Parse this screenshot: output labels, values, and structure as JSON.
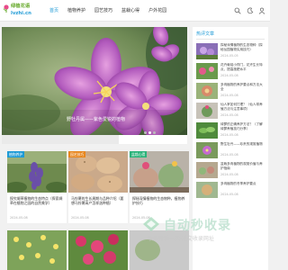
{
  "header": {
    "logo_text": "绿植花语",
    "logo_sub": "lvzhi.cn",
    "nav": [
      {
        "label": "首页"
      },
      {
        "label": "植物养护"
      },
      {
        "label": "园艺技巧"
      },
      {
        "label": "盆栽心得"
      },
      {
        "label": "户外花园"
      }
    ]
  },
  "hero": {
    "caption": "野牡丹属——紫色爱锐的植物"
  },
  "sidebar": {
    "title": "热评文章",
    "items": [
      {
        "text": "探秘深情植物的生态物种（探秘丛园植物实用技巧）",
        "date": "2024-05-05"
      },
      {
        "text": "花卉栽培小窍门，花卉生长特点，提高施肥水平",
        "date": "2024-05-08"
      },
      {
        "text": "多肉植物的养护要点和方法大全",
        "date": "2024-05-08"
      },
      {
        "text": "仙人掌如何打理？（仙人球养殖方法与注意事项）",
        "date": "2024-05-08"
      },
      {
        "text": "绿萝的正确养护方法？（了解绿萝养殖技巧分享）",
        "date": "2024-05-08"
      },
      {
        "text": "野生牡丹——珍贵的观赏植物",
        "date": "2024-05-08"
      },
      {
        "text": "盆栽多肉植物的观赏价值与养护指南",
        "date": "2024-05-08"
      },
      {
        "text": "多肉植物的冬季养护要点",
        "date": "2024-05-08"
      }
    ]
  },
  "cards": [
    {
      "tag": "植物养护",
      "title": "探究缬草植物的生态特点（探索缬草在植物之园的自然美学）",
      "meta": "2024-05-08"
    },
    {
      "tag": "园艺技巧",
      "title": "马铃薯的生长周期与品种介绍（要想马铃薯高产怎样选种植）",
      "meta": "2024-05-08"
    },
    {
      "tag": "盆栽心得",
      "title": "探秘深情植物的生态物种，植物养护技巧",
      "meta": "2024-05-08"
    }
  ],
  "watermark": {
    "title": "自动秒收录",
    "sub": "收录更新一次·提交收录网址"
  },
  "icons": {
    "search": "search-icon",
    "moon": "moon-icon",
    "user": "user-icon"
  }
}
